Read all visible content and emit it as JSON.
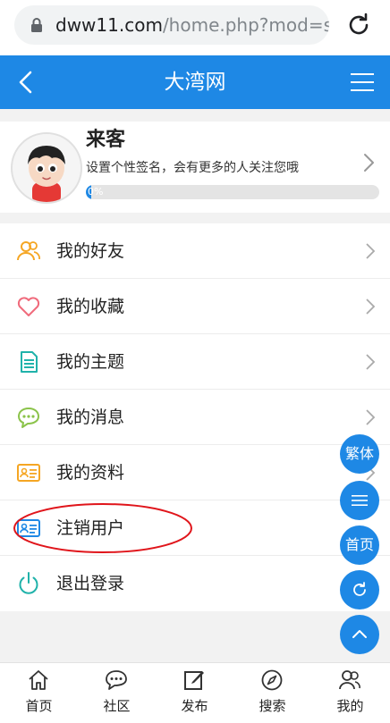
{
  "browser": {
    "url_domain": "dww11.com",
    "url_path": "/home.php?mod=spac",
    "lock_icon": "lock-icon",
    "reload_icon": "reload-icon"
  },
  "header": {
    "title": "大湾网",
    "back_icon": "chevron-left-icon",
    "menu_icon": "hamburger-menu-icon",
    "background": "#1e88e5"
  },
  "profile": {
    "name": "来客",
    "signature_hint": "设置个性签名，会有更多的人关注您哦",
    "progress_text": "0%",
    "progress_value": 0
  },
  "menu": {
    "items": [
      {
        "label": "我的好友",
        "icon": "friends-icon",
        "color": "#f5a623"
      },
      {
        "label": "我的收藏",
        "icon": "heart-icon",
        "color": "#f06b7c"
      },
      {
        "label": "我的主题",
        "icon": "document-icon",
        "color": "#20b2aa"
      },
      {
        "label": "我的消息",
        "icon": "message-icon",
        "color": "#8bc34a"
      },
      {
        "label": "我的资料",
        "icon": "id-card-icon",
        "color": "#f5a623"
      },
      {
        "label": "注销用户",
        "icon": "id-card-icon",
        "color": "#1e88e5"
      },
      {
        "label": "退出登录",
        "icon": "power-icon",
        "color": "#20b2aa"
      }
    ]
  },
  "fabs": {
    "traditional_label": "繁体",
    "home_label": "首页",
    "menu_icon": "list-icon",
    "refresh_icon": "refresh-icon",
    "top_icon": "chevron-up-icon"
  },
  "bottom_nav": {
    "items": [
      {
        "label": "首页",
        "icon": "home-icon"
      },
      {
        "label": "社区",
        "icon": "chat-icon"
      },
      {
        "label": "发布",
        "icon": "edit-icon"
      },
      {
        "label": "搜索",
        "icon": "compass-icon"
      },
      {
        "label": "我的",
        "icon": "user-icon"
      }
    ]
  }
}
